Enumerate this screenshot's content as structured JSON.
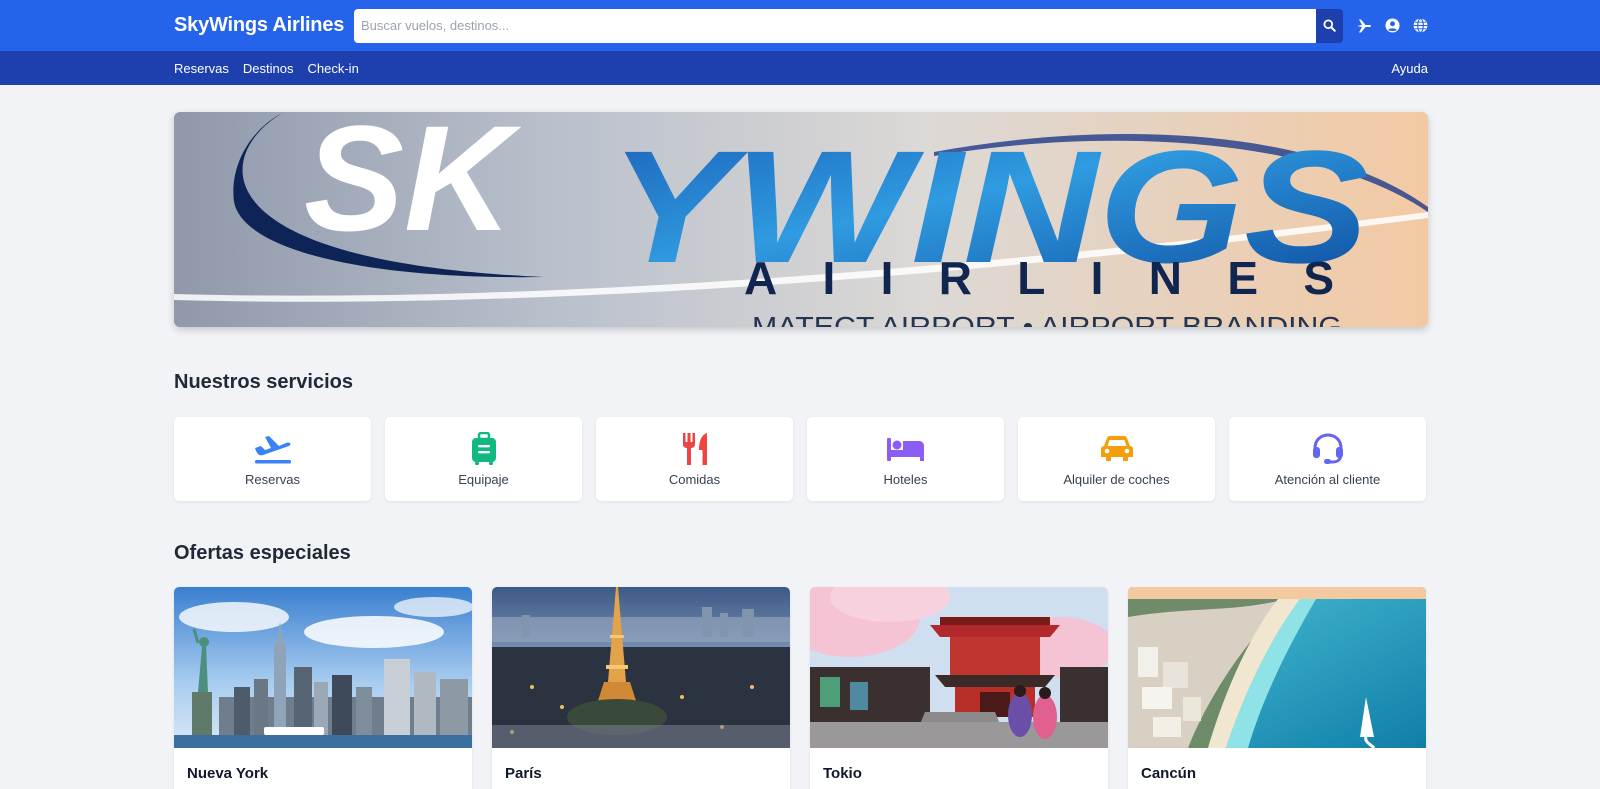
{
  "header": {
    "brand": "SkyWings Airlines",
    "search_placeholder": "Buscar vuelos, destinos...",
    "icons": [
      "search-icon",
      "plane-icon",
      "user-circle-icon",
      "globe-icon"
    ]
  },
  "subnav": {
    "links": [
      "Reservas",
      "Destinos",
      "Check-in"
    ],
    "help": "Ayuda"
  },
  "hero": {
    "logo_word_1": "SK",
    "logo_word_2": "YWINGS",
    "logo_word_3": "AIIRLINES",
    "tagline": "MATECT AIRPORT • AIRPORT BRANDING"
  },
  "services": {
    "title": "Nuestros servicios",
    "items": [
      {
        "label": "Reservas",
        "icon": "plane-departure-icon",
        "color": "#3b82f6"
      },
      {
        "label": "Equipaje",
        "icon": "suitcase-icon",
        "color": "#10b981"
      },
      {
        "label": "Comidas",
        "icon": "utensils-icon",
        "color": "#ef4444"
      },
      {
        "label": "Hoteles",
        "icon": "bed-icon",
        "color": "#8b5cf6"
      },
      {
        "label": "Alquiler de coches",
        "icon": "car-icon",
        "color": "#f59e0b"
      },
      {
        "label": "Atención al cliente",
        "icon": "headset-icon",
        "color": "#6366f1"
      }
    ]
  },
  "offers": {
    "title": "Ofertas especiales",
    "items": [
      {
        "city": "Nueva York"
      },
      {
        "city": "París"
      },
      {
        "city": "Tokio"
      },
      {
        "city": "Cancún"
      }
    ]
  },
  "colors": {
    "topbar": "#2563eb",
    "subnav": "#1e40af",
    "background": "#f1f3f6"
  }
}
